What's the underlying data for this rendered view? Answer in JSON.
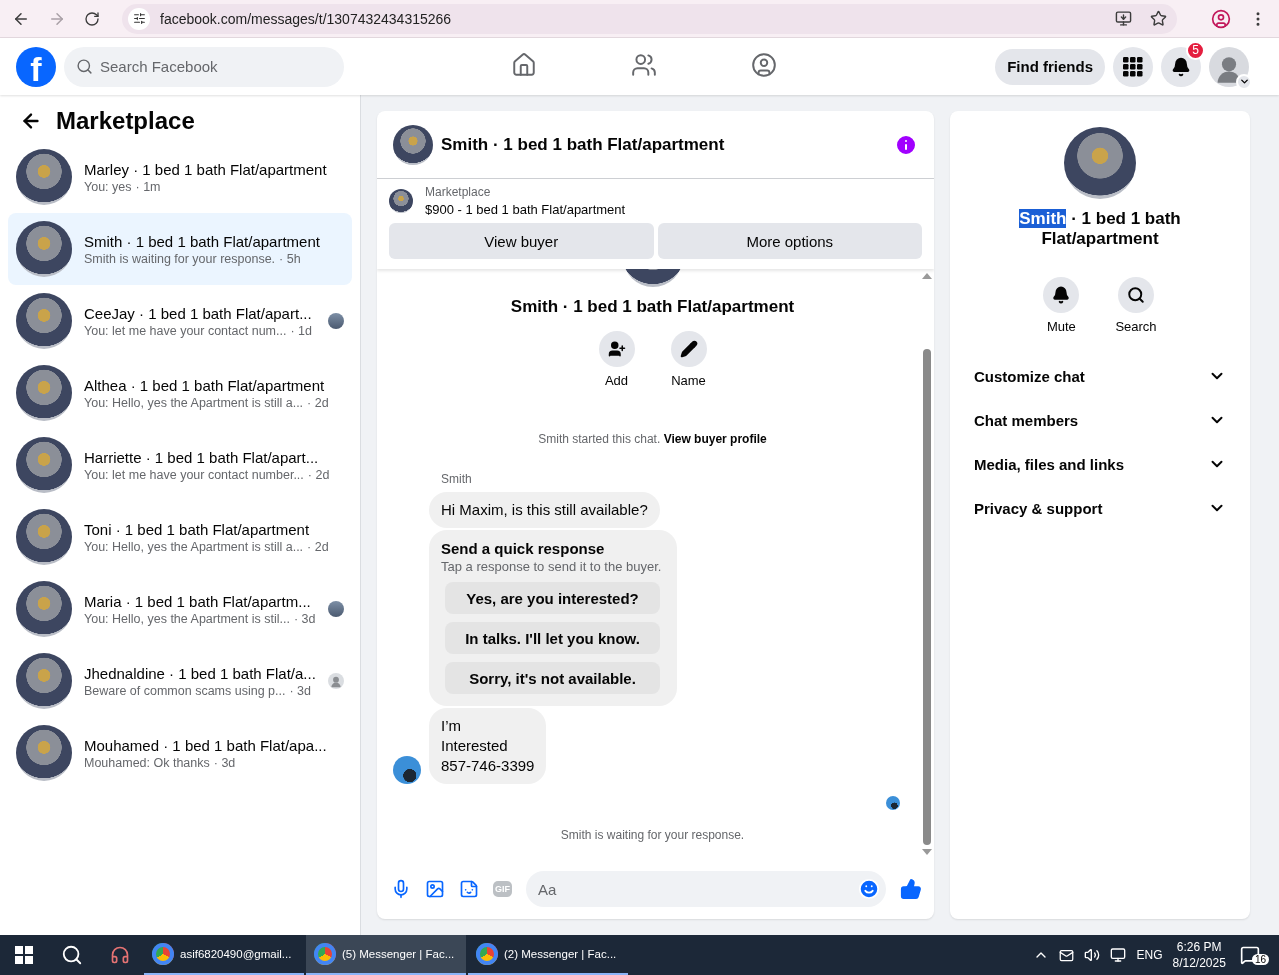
{
  "browser": {
    "url": "facebook.com/messages/t/1307432434315266"
  },
  "header": {
    "logo": "f",
    "search_placeholder": "Search Facebook",
    "find_friends": "Find friends",
    "notification_count": "5",
    "nav": [
      {
        "kind": "home",
        "selected": false
      },
      {
        "kind": "friends",
        "selected": false
      },
      {
        "kind": "groups",
        "selected": false
      }
    ]
  },
  "sidebar": {
    "title": "Marketplace",
    "conversations": [
      {
        "name": "Marley · 1 bed 1 bath Flat/apartment",
        "snippet": "You: yes",
        "time": "· 1m",
        "selected": false
      },
      {
        "name": "Smith · 1 bed 1 bath Flat/apartment",
        "snippet": "Smith is waiting for your response.",
        "time": "· 5h",
        "selected": true
      },
      {
        "name": "CeeJay · 1 bed 1 bath Flat/apart...",
        "snippet": "You: let me have your contact num...",
        "time": "· 1d",
        "selected": false,
        "receipt": {
          "kind": "photo"
        }
      },
      {
        "name": "Althea · 1 bed 1 bath Flat/apartment",
        "snippet": "You: Hello, yes the Apartment is still a...",
        "time": "· 2d",
        "selected": false
      },
      {
        "name": "Harriette · 1 bed 1 bath Flat/apart...",
        "snippet": "You: let me have your contact number...",
        "time": "· 2d",
        "selected": false
      },
      {
        "name": "Toni · 1 bed 1 bath Flat/apartment",
        "snippet": "You: Hello, yes the Apartment is still a...",
        "time": "· 2d",
        "selected": false
      },
      {
        "name": "Maria · 1 bed 1 bath Flat/apartm...",
        "snippet": "You: Hello, yes the Apartment is stil...",
        "time": "· 3d",
        "selected": false,
        "receipt": {
          "kind": "photo"
        }
      },
      {
        "name": "Jhednaldine · 1 bed 1 bath Flat/a...",
        "snippet": "Beware of common scams using p...",
        "time": "· 3d",
        "selected": false,
        "receipt": {
          "kind": "silhouette"
        }
      },
      {
        "name": "Mouhamed · 1 bed 1 bath Flat/apa...",
        "snippet": "Mouhamed: Ok thanks",
        "time": "· 3d",
        "selected": false
      }
    ]
  },
  "chat": {
    "title": "Smith · 1 bed 1 bath Flat/apartment",
    "listing": {
      "label": "Marketplace",
      "text": "$900 - 1 bed 1 bath Flat/apartment"
    },
    "buttons": [
      "View buyer",
      "More options"
    ],
    "profile_name": "Smith · 1 bed 1 bath Flat/apartment",
    "profile_actions": [
      {
        "kind": "add",
        "label": "Add"
      },
      {
        "kind": "name",
        "label": "Name"
      }
    ],
    "started_text": "Smith started this chat.",
    "started_link": "View buyer profile",
    "sender": "Smith",
    "messages": [
      {
        "kind": "text",
        "lines": [
          "Hi Maxim, is this still available?"
        ]
      },
      {
        "kind": "quick",
        "title": "Send a quick response",
        "subtitle": "Tap a response to send it to the buyer.",
        "options": [
          "Yes, are you interested?",
          "In talks. I'll let you know.",
          "Sorry, it's not available."
        ]
      },
      {
        "kind": "text",
        "lines": [
          "I’m",
          "Interested",
          "857-746-3399"
        ]
      }
    ],
    "waiting": "Smith is waiting for your response.",
    "composer": {
      "placeholder": "Aa",
      "gif": "GIF"
    }
  },
  "details": {
    "title_selected": "Smith",
    "title_rest": "· 1 bed 1 bath Flat/apartment",
    "actions": [
      {
        "kind": "mute",
        "label": "Mute"
      },
      {
        "kind": "search",
        "label": "Search"
      }
    ],
    "sections": [
      {
        "label": "Customize chat",
        "expanded": false
      },
      {
        "label": "Chat members",
        "expanded": false
      },
      {
        "label": "Media, files and links",
        "expanded": false
      },
      {
        "label": "Privacy & support",
        "expanded": false
      }
    ]
  },
  "taskbar": {
    "apps": [
      {
        "label": "asif6820490@gmail...",
        "active": false
      },
      {
        "label": "(5) Messenger | Fac...",
        "active": true
      },
      {
        "label": "(2) Messenger | Fac...",
        "active": false
      }
    ],
    "language": "ENG",
    "time": "6:26 PM",
    "date": "8/12/2025",
    "notifications": "16"
  }
}
